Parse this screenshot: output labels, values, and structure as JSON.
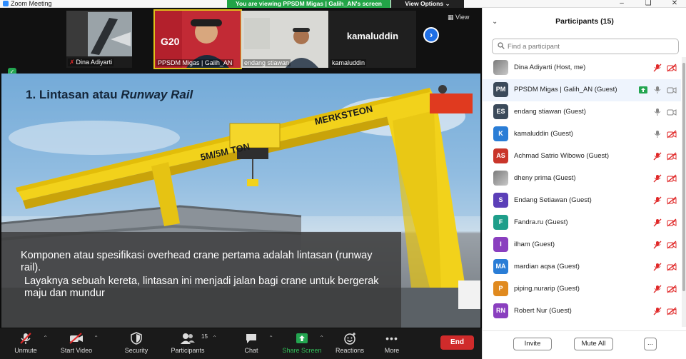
{
  "window": {
    "app_title": "Zoom Meeting",
    "share_banner": "You are viewing PPSDM Migas | Galih_AN's screen",
    "view_options": "View Options ⌄",
    "controls": [
      "–",
      "❏",
      "✕"
    ]
  },
  "thumbnails": [
    {
      "name": "Dina Adiyarti",
      "muted": true,
      "kind": "video"
    },
    {
      "name": "PPSDM Migas | Galih_AN",
      "muted": false,
      "kind": "video",
      "active": true
    },
    {
      "name": "endang stiawan",
      "muted": false,
      "kind": "video"
    },
    {
      "name": "kamaluddin",
      "muted": false,
      "kind": "name-only",
      "big_label": "kamaluddin"
    }
  ],
  "view_button": "View",
  "slide": {
    "title_plain": "1. Lintasan atau ",
    "title_italic": "Runway Rail",
    "beam_text": "5M/5M TON",
    "brand_text": "MERKSTEON",
    "caption_line1": "Komponen atau spesifikasi overhead crane pertama adalah lintasan (runway rail).",
    "caption_line2": "Layaknya sebuah kereta, lintasan ini menjadi jalan bagi crane untuk bergerak maju dan mundur"
  },
  "toolbar": {
    "unmute": "Unmute",
    "start_video": "Start Video",
    "security": "Security",
    "participants": "Participants",
    "participants_count": "15",
    "chat": "Chat",
    "share_screen": "Share Screen",
    "reactions": "Reactions",
    "more": "More",
    "end": "End"
  },
  "panel": {
    "title": "Participants (15)",
    "search_placeholder": "Find a participant",
    "invite": "Invite",
    "mute_all": "Mute All",
    "more": "..."
  },
  "participants": [
    {
      "initials": "",
      "name": "Dina Adiyarti (Host, me)",
      "color": "",
      "photo": true,
      "mic": "muted",
      "cam": "off"
    },
    {
      "initials": "PM",
      "name": "PPSDM Migas | Galih_AN (Guest)",
      "color": "#3b4a5a",
      "photo": false,
      "mic": "on",
      "cam": "on",
      "sharing": true,
      "highlight": true
    },
    {
      "initials": "ES",
      "name": "endang stiawan (Guest)",
      "color": "#3b4a5a",
      "photo": false,
      "mic": "on",
      "cam": "on"
    },
    {
      "initials": "K",
      "name": "kamaluddin (Guest)",
      "color": "#2a7dd6",
      "photo": false,
      "mic": "on",
      "cam": "off"
    },
    {
      "initials": "AS",
      "name": "Achmad Satrio Wibowo (Guest)",
      "color": "#c9352a",
      "photo": false,
      "mic": "muted",
      "cam": "off"
    },
    {
      "initials": "",
      "name": "dheny prima (Guest)",
      "color": "",
      "photo": true,
      "mic": "muted",
      "cam": "off"
    },
    {
      "initials": "S",
      "name": "Endang Setiawan (Guest)",
      "color": "#5b3fb8",
      "photo": false,
      "mic": "muted",
      "cam": "off"
    },
    {
      "initials": "F",
      "name": "Fandra.ru (Guest)",
      "color": "#1e9e8a",
      "photo": false,
      "mic": "muted",
      "cam": "off"
    },
    {
      "initials": "I",
      "name": "ilham (Guest)",
      "color": "#8a3fbf",
      "photo": false,
      "mic": "muted",
      "cam": "off"
    },
    {
      "initials": "MA",
      "name": "mardian aqsa (Guest)",
      "color": "#2a7dd6",
      "photo": false,
      "mic": "muted",
      "cam": "off"
    },
    {
      "initials": "P",
      "name": "piping.nurarip (Guest)",
      "color": "#e08a1f",
      "photo": false,
      "mic": "muted",
      "cam": "off"
    },
    {
      "initials": "RN",
      "name": "Robert Nur (Guest)",
      "color": "#8a3fbf",
      "photo": false,
      "mic": "muted",
      "cam": "off"
    }
  ],
  "colors": {
    "zoom_blue": "#2d8cff",
    "share_green": "#22a447",
    "end_red": "#d02b2b",
    "muted_red": "#e02828",
    "crane_yellow": "#f2d21b"
  }
}
